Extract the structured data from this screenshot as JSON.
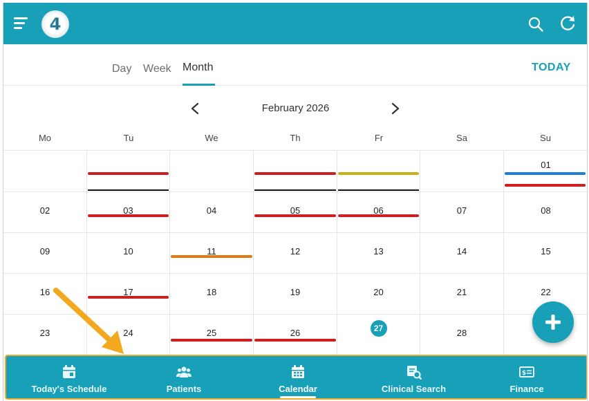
{
  "header": {
    "logo_text": "4",
    "icons": [
      "menu-icon",
      "search-icon",
      "refresh-icon"
    ]
  },
  "view_tabs": {
    "day": "Day",
    "week": "Week",
    "month": "Month",
    "active": "Month",
    "today_label": "TODAY"
  },
  "calendar": {
    "month_title": "February 2026",
    "weekdays": [
      "Mo",
      "Tu",
      "We",
      "Th",
      "Fr",
      "Sa",
      "Su"
    ],
    "today": "27",
    "colors": {
      "accent": "#17a0b8",
      "red": "#cc1f1f",
      "yellow": "#c7b21a",
      "orange": "#e07a12",
      "blue": "#1f7fd6",
      "black": "#111111"
    },
    "weeks": [
      [
        "",
        "",
        "",
        "",
        "",
        "",
        "01"
      ],
      [
        "02",
        "03",
        "04",
        "05",
        "06",
        "07",
        "08"
      ],
      [
        "09",
        "10",
        "11",
        "12",
        "13",
        "14",
        "15"
      ],
      [
        "16",
        "17",
        "18",
        "19",
        "20",
        "21",
        "22"
      ],
      [
        "23",
        "24",
        "25",
        "26",
        "27",
        "28",
        ""
      ]
    ]
  },
  "fab": {
    "icon": "plus-icon"
  },
  "bottom_nav": {
    "items": [
      {
        "label": "Today's Schedule",
        "icon": "calendar-day-icon"
      },
      {
        "label": "Patients",
        "icon": "users-icon"
      },
      {
        "label": "Calendar",
        "icon": "calendar-icon"
      },
      {
        "label": "Clinical Search",
        "icon": "clinical-search-icon"
      },
      {
        "label": "Finance",
        "icon": "money-icon"
      }
    ],
    "active": "Calendar",
    "highlight_color": "#f0a928"
  }
}
